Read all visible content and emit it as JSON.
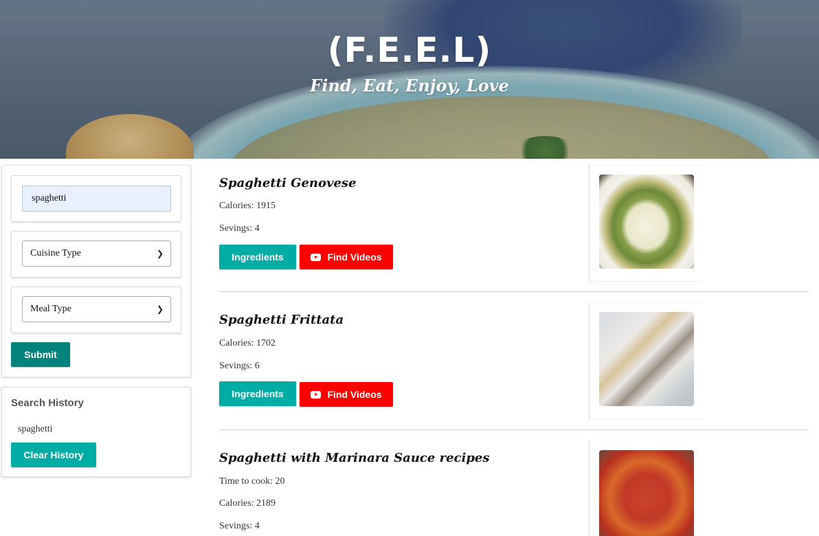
{
  "hero": {
    "title": "(F.E.E.L)",
    "tagline": "Find, Eat, Enjoy, Love"
  },
  "search": {
    "query_value": "spaghetti",
    "cuisine_select": "Cuisine Type",
    "meal_select": "Meal Type",
    "submit_label": "Submit"
  },
  "history": {
    "title": "Search History",
    "items": [
      "spaghetti"
    ],
    "clear_label": "Clear History"
  },
  "recipes": [
    {
      "title": "Spaghetti Genovese",
      "calories": "Calories: 1915",
      "servings": "Sevings: 4",
      "ingredients_label": "Ingredients",
      "videos_label": "Find Videos"
    },
    {
      "title": "Spaghetti Frittata",
      "calories": "Calories: 1702",
      "servings": "Sevings: 6",
      "ingredients_label": "Ingredients",
      "videos_label": "Find Videos"
    },
    {
      "title": "Spaghetti with Marinara Sauce recipes",
      "time": "Time to cook: 20",
      "calories": "Calories: 2189",
      "servings": "Sevings: 4"
    }
  ],
  "colors": {
    "teal_button": "#00ada4",
    "submit_button": "#00837a",
    "video_button": "#ff0000"
  },
  "icons": {
    "video": "youtube-icon",
    "select": "chevron-down-icon"
  }
}
